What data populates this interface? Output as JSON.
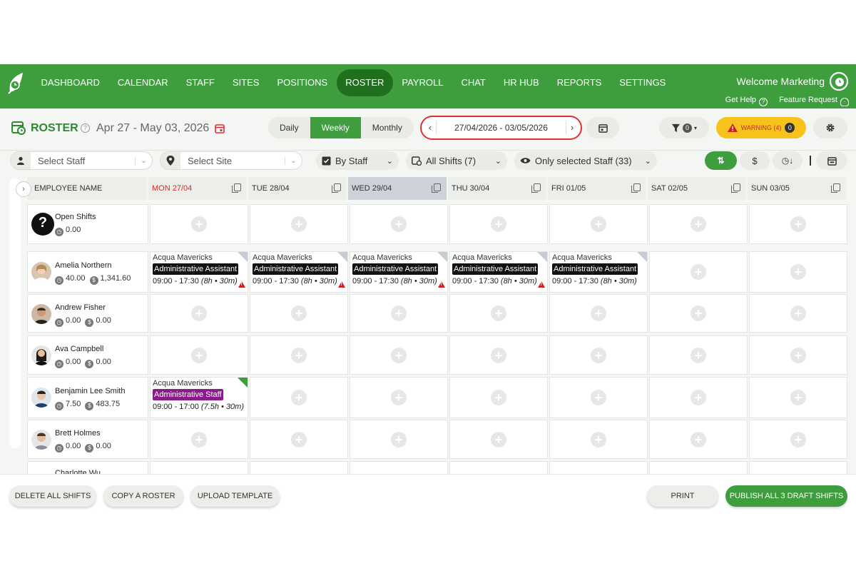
{
  "nav": {
    "items": [
      "DASHBOARD",
      "CALENDAR",
      "STAFF",
      "SITES",
      "POSITIONS",
      "ROSTER",
      "PAYROLL",
      "CHAT",
      "HR HUB",
      "REPORTS",
      "SETTINGS"
    ],
    "active": "ROSTER",
    "welcome": "Welcome Marketing",
    "get_help": "Get Help",
    "feature_request": "Feature Request"
  },
  "header": {
    "title": "ROSTER",
    "date_range": "Apr 27 - May 03, 2026",
    "views": [
      "Daily",
      "Weekly",
      "Monthly"
    ],
    "active_view": "Weekly",
    "picker_value": "27/04/2026 - 03/05/2026",
    "filter_count": "0",
    "warning_label": "WARNING (4)",
    "warning_count": "0"
  },
  "filters": {
    "staff_placeholder": "Select Staff",
    "site_placeholder": "Select Site",
    "group_by": "By Staff",
    "shifts": "All Shifts (7)",
    "visibility": "Only selected Staff (33)"
  },
  "grid": {
    "employee_header": "EMPLOYEE NAME",
    "days": [
      "MON 27/04",
      "TUE 28/04",
      "WED 29/04",
      "THU 30/04",
      "FRI 01/05",
      "SAT 02/05",
      "SUN 03/05"
    ],
    "rows": [
      {
        "name": "Open Shifts",
        "hours": "0.00",
        "cost": ""
      },
      {
        "name": "Amelia Northern",
        "hours": "40.00",
        "cost": "1,341.60"
      },
      {
        "name": "Andrew Fisher",
        "hours": "0.00",
        "cost": "0.00"
      },
      {
        "name": "Ava Campbell",
        "hours": "0.00",
        "cost": "0.00"
      },
      {
        "name": "Benjamin Lee Smith",
        "hours": "7.50",
        "cost": "483.75"
      },
      {
        "name": "Brett Holmes",
        "hours": "0.00",
        "cost": "0.00"
      },
      {
        "name": "Charlotte Wu",
        "hours": "",
        "cost": ""
      }
    ],
    "shift_amelia": {
      "site": "Acqua Mavericks",
      "position": "Administrative Assistant",
      "time": "09:00 - 17:30",
      "duration": "(8h • 30m)"
    },
    "shift_benjamin": {
      "site": "Acqua Mavericks",
      "position": "Administrative Staff",
      "time": "09:00 - 17:00",
      "duration": "(7.5h • 30m)"
    }
  },
  "footer": {
    "delete_all": "DELETE ALL SHIFTS",
    "copy_roster": "COPY A ROSTER",
    "upload_template": "UPLOAD TEMPLATE",
    "print": "PRINT",
    "publish": "PUBLISH ALL 3 DRAFT SHIFTS"
  },
  "colors": {
    "brand_green": "#3e9e3e",
    "nav_active": "#1f6f1f",
    "warning_yellow": "#f7c21c",
    "today_red": "#d03030",
    "position_black": "#111111",
    "position_purple": "#8b1a8b"
  }
}
